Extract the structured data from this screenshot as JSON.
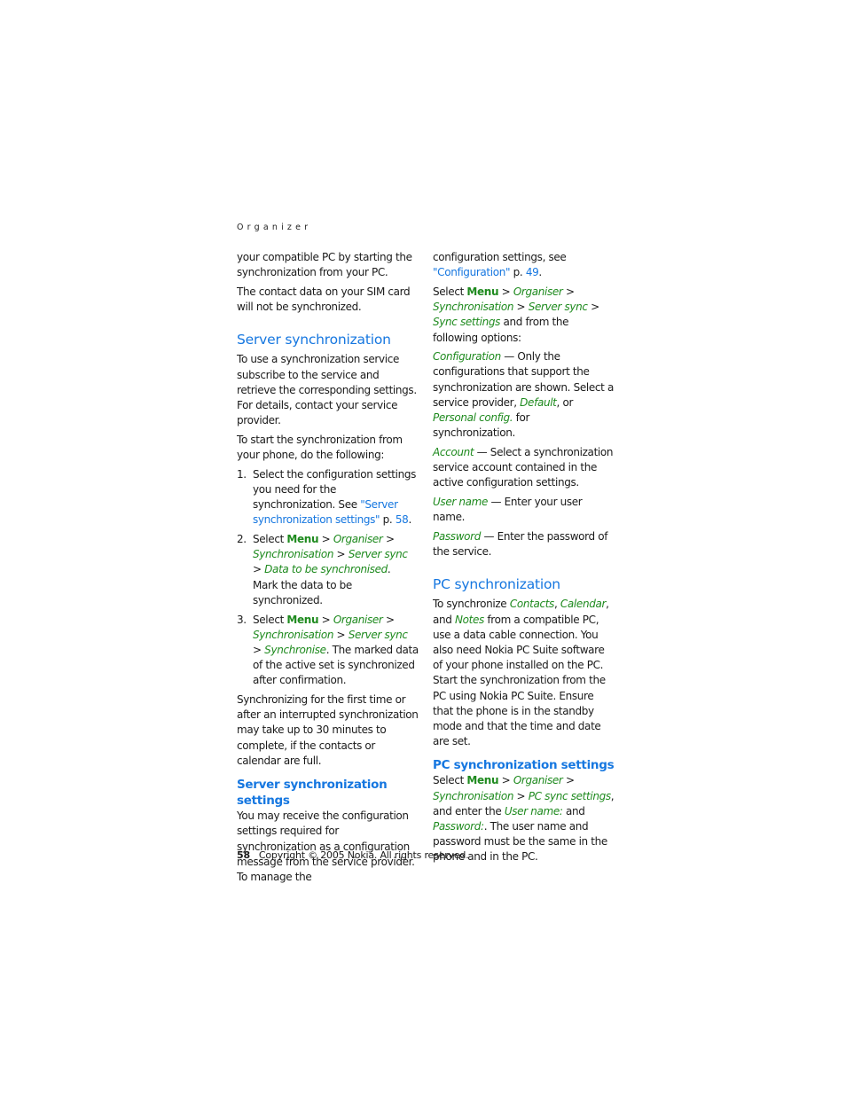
{
  "running_head": "Organizer",
  "left": {
    "intro1": "your compatible PC by starting the synchronization from your PC.",
    "intro2": "The contact data on your SIM card will not be synchronized.",
    "server_sync": {
      "heading": "Server synchronization",
      "p1": "To use a synchronization service subscribe to the service and retrieve the corresponding settings. For details, contact your service provider.",
      "p2": "To start the synchronization from your phone, do the following:",
      "steps": [
        {
          "num": "1.",
          "text_a": "Select the configuration settings you need for the synchronization. See ",
          "link": "\"Server synchronization settings\"",
          "text_b": " p. ",
          "page": "58",
          "text_c": "."
        },
        {
          "num": "2.",
          "select": "Select ",
          "menu": "Menu",
          "sep": " > ",
          "path1": "Organiser",
          "path2": "Synchronisation",
          "path3": "Server sync",
          "path4": "Data to be synchronised",
          "tail": ". Mark the data to be synchronized."
        },
        {
          "num": "3.",
          "select": "Select ",
          "menu": "Menu",
          "sep": " > ",
          "path1": "Organiser",
          "path2": "Synchronisation",
          "path3": "Server sync",
          "path4": "Synchronise",
          "tail": ". The marked data of the active set is synchronized after confirmation."
        }
      ],
      "p3": "Synchronizing for the first time or after an interrupted synchronization may take up to 30 minutes to complete, if the contacts or calendar are full."
    },
    "server_sync_settings": {
      "heading": "Server synchronization settings",
      "p1": "You may receive the configuration settings required for synchronization as a configuration message from the service provider. To manage the"
    }
  },
  "right": {
    "cont_a": "configuration settings, see ",
    "cont_link": "\"Configuration\"",
    "cont_b": " p. ",
    "cont_page": "49",
    "cont_c": ".",
    "select_para": {
      "select": "Select ",
      "menu": "Menu",
      "sep": " > ",
      "path1": "Organiser",
      "path2": "Synchronisation",
      "path3": "Server sync",
      "path4": "Sync settings",
      "tail": " and from the following options:"
    },
    "options": {
      "configuration": {
        "term": "Configuration",
        "text_a": " — Only the configurations that support the synchronization are shown. Select a service provider, ",
        "opt1": "Default",
        "text_b": ", or ",
        "opt2": "Personal config.",
        "text_c": " for synchronization."
      },
      "account": {
        "term": "Account",
        "text": " — Select a synchronization service account contained in the active configuration settings."
      },
      "user_name": {
        "term": "User name",
        "text": " — Enter your user name."
      },
      "password": {
        "term": "Password",
        "text": " — Enter the password of the service."
      }
    },
    "pc_sync": {
      "heading": "PC synchronization",
      "text_a": "To synchronize ",
      "item1": "Contacts",
      "c1": ", ",
      "item2": "Calendar",
      "c2": ", and ",
      "item3": "Notes",
      "text_b": " from a compatible PC, use a data cable connection. You also need Nokia PC Suite software of your phone installed on the PC. Start the synchronization from the PC using Nokia PC Suite. Ensure that the phone is in the standby mode and that the time and date are set."
    },
    "pc_sync_settings": {
      "heading": "PC synchronization settings",
      "select": "Select ",
      "menu": "Menu",
      "sep": " > ",
      "path1": "Organiser",
      "path2": "Synchronisation",
      "path3": "PC sync settings",
      "text_a": ", and enter the ",
      "field1": "User name:",
      "text_b": " and ",
      "field2": "Password:",
      "text_c": ". The user name and password must be the same in the phone and in the PC."
    }
  },
  "footer": {
    "page_number": "58",
    "copyright": "Copyright © 2005 Nokia. All rights reserved."
  }
}
